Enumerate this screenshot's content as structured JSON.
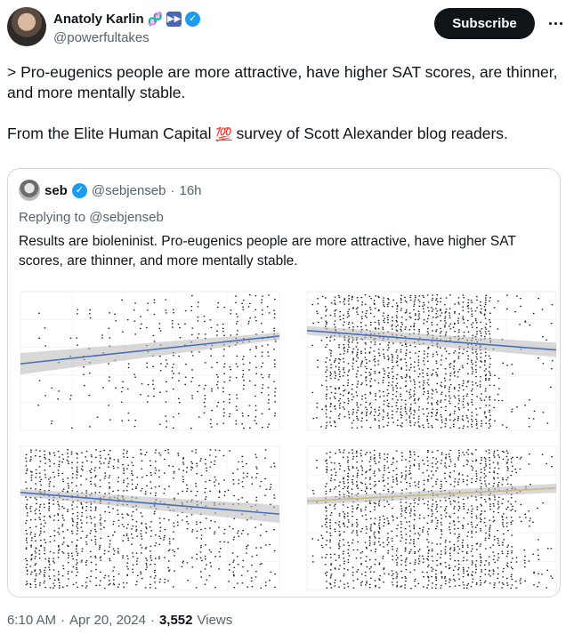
{
  "author": {
    "name": "Anatoly Karlin",
    "handle": "@powerfultakes",
    "badges": [
      "dna-icon",
      "fast-forward-icon",
      "verified-icon"
    ]
  },
  "actions": {
    "subscribe_label": "Subscribe"
  },
  "tweet": {
    "line1": "> Pro-eugenics people are more attractive, have higher SAT scores, are thinner, and more mentally stable.",
    "line2_before": "From the Elite Human Capital ",
    "line2_emoji": "💯",
    "line2_after": " survey of Scott Alexander blog readers."
  },
  "quoted": {
    "name": "seb",
    "handle": "@sebjenseb",
    "dot": "·",
    "time": "16h",
    "replying_to": "Replying to @sebjenseb",
    "text": "Results are bioleninist. Pro-eugenics people are more attractive, have higher SAT scores, are thinner, and more mentally stable."
  },
  "footer": {
    "time": "6:10 AM",
    "dot1": "·",
    "date": "Apr 20, 2024",
    "dot2": "·",
    "views_count": "3,552",
    "views_label": "Views"
  },
  "colors": {
    "accent": "#1d9bf0",
    "text": "#0f1419",
    "muted": "#536471",
    "border": "#cfd9de",
    "trend_blue": "#4a6fb8",
    "trend_tan": "#c9b98a",
    "ci_band": "#b8b8b8"
  }
}
